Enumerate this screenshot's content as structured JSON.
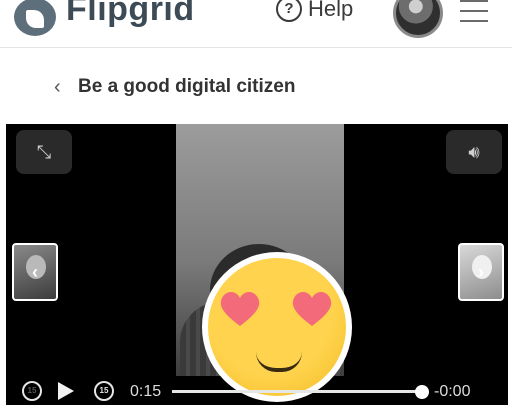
{
  "header": {
    "brand": "Flipgrid",
    "help_label": "Help",
    "help_icon": "help-chat-icon",
    "menu_icon": "hamburger-icon"
  },
  "page": {
    "back_icon": "chevron-left-icon",
    "title": "Be a good digital citizen"
  },
  "player": {
    "expand_icon": "expand-icon",
    "volume_icon": "volume-icon",
    "prev_icon": "chevron-left-icon",
    "next_icon": "chevron-right-icon",
    "rewind_label": "15",
    "forward_label": "15",
    "time_elapsed": "0:15",
    "time_remaining": "-0:00",
    "progress": 1.0
  },
  "colors": {
    "emoji_yellow": "#ffd34d",
    "heart_pink": "#f36a7a",
    "player_bg": "#000000"
  }
}
